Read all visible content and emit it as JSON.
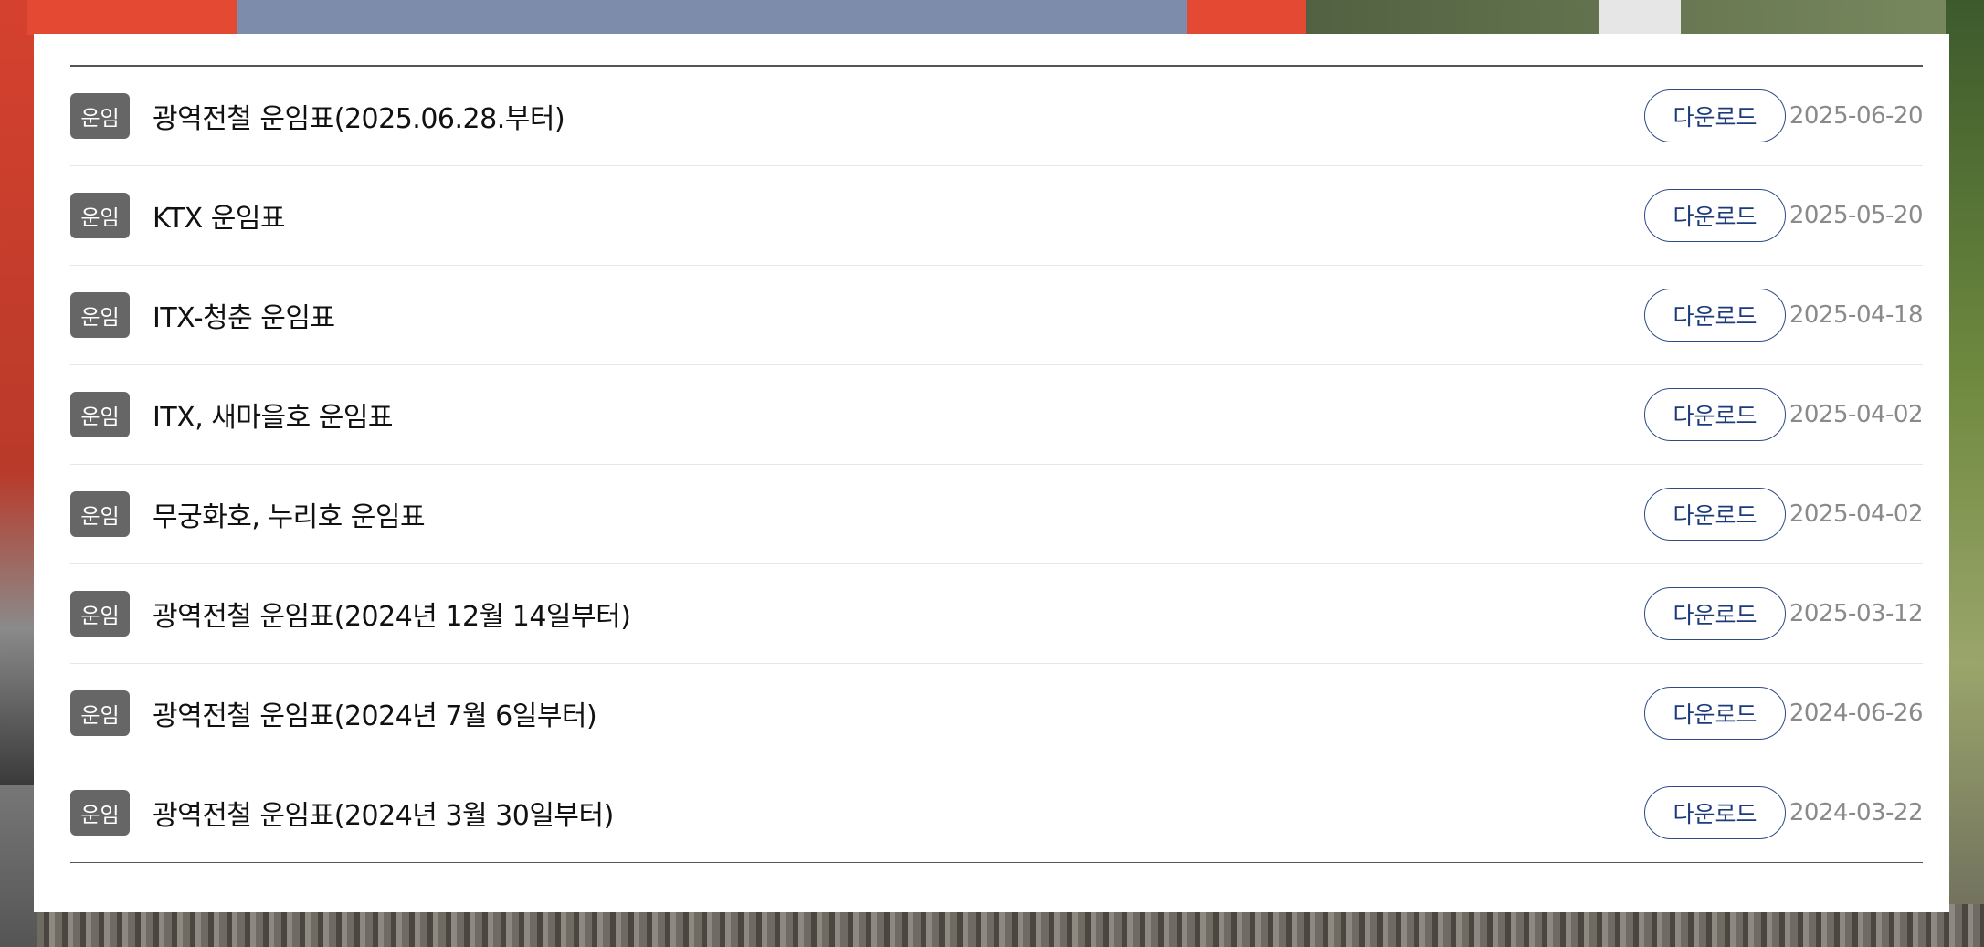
{
  "list": {
    "items": [
      {
        "category": "운임",
        "title": "광역전철 운임표(2025.06.28.부터)",
        "action": "다운로드",
        "date": "2025-06-20"
      },
      {
        "category": "운임",
        "title": "KTX 운임표",
        "action": "다운로드",
        "date": "2025-05-20"
      },
      {
        "category": "운임",
        "title": "ITX-청춘 운임표",
        "action": "다운로드",
        "date": "2025-04-18"
      },
      {
        "category": "운임",
        "title": "ITX, 새마을호 운임표",
        "action": "다운로드",
        "date": "2025-04-02"
      },
      {
        "category": "운임",
        "title": "무궁화호, 누리호 운임표",
        "action": "다운로드",
        "date": "2025-04-02"
      },
      {
        "category": "운임",
        "title": "광역전철 운임표(2024년 12월 14일부터)",
        "action": "다운로드",
        "date": "2025-03-12"
      },
      {
        "category": "운임",
        "title": "광역전철 운임표(2024년 7월 6일부터)",
        "action": "다운로드",
        "date": "2024-06-26"
      },
      {
        "category": "운임",
        "title": "광역전철 운임표(2024년 3월 30일부터)",
        "action": "다운로드",
        "date": "2024-03-22"
      }
    ]
  },
  "colors": {
    "badge_bg": "#666666",
    "button_border": "#2f4b86",
    "button_text": "#1d3b7a",
    "date_text": "#8a8a8a"
  }
}
